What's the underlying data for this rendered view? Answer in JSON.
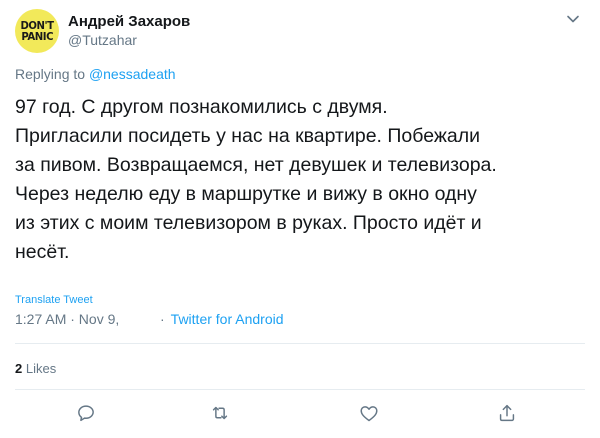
{
  "author": {
    "avatar_text_line1": "DON'T",
    "avatar_text_line2": "PANIC",
    "display_name": "Андрей Захаров",
    "handle": "@Tutzahar"
  },
  "reply": {
    "prefix": "Replying to",
    "mention": "@nessadeath"
  },
  "tweet": {
    "text": "97 год. С другом познакомились с двумя.\nПригласили посидеть у нас на квартире. Побежали\nза пивом. Возвращаемся, нет девушек и телевизора.\nЧерез неделю еду в маршрутке и вижу в окно одну\nиз этих с моим телевизором в руках. Просто идёт и\nнесёт.",
    "translate_label": "Translate Tweet",
    "timestamp": "1:27 AM · Nov 9,",
    "source_separator": "·",
    "source": "Twitter for Android"
  },
  "stats": {
    "likes_count": "2",
    "likes_label": "Likes"
  },
  "actions": [
    {
      "icon": "reply-icon"
    },
    {
      "icon": "retweet-icon"
    },
    {
      "icon": "like-icon"
    },
    {
      "icon": "share-icon"
    }
  ],
  "colors": {
    "accent": "#1da1f2",
    "secondary_text": "#657786",
    "primary_text": "#14171a",
    "divider": "#e6ecf0",
    "avatar_bg": "#f2e95a"
  }
}
